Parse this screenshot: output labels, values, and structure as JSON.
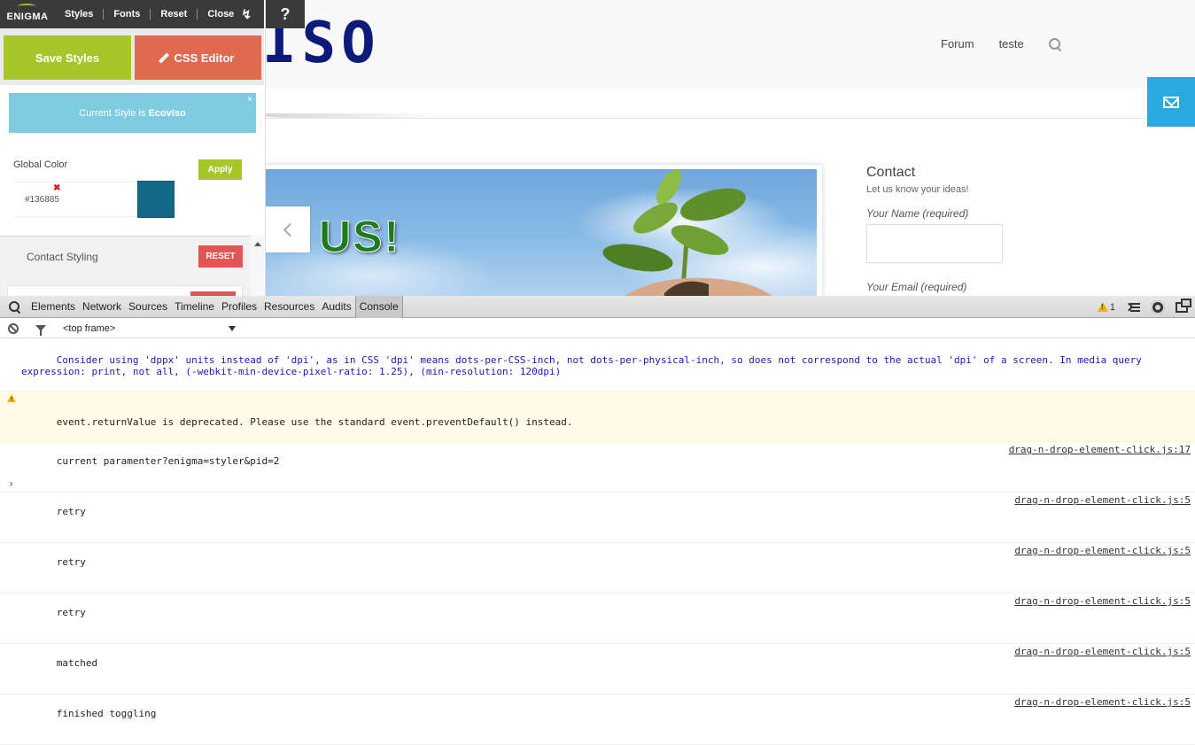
{
  "site": {
    "logo_text": "ISO",
    "nav": [
      "Forum",
      "teste"
    ],
    "slide_text": "US!",
    "contact": {
      "title": "Contact",
      "subtitle": "Let us know your ideas!",
      "name_label": "Your Name (required)",
      "email_label": "Your Email (required)"
    }
  },
  "enigma": {
    "toolbar": {
      "logo": "ENIGMA",
      "items": [
        "Styles",
        "Fonts",
        "Reset",
        "Close"
      ],
      "reload_icon": "↯",
      "help": "?"
    },
    "save_styles": "Save Styles",
    "css_editor": "CSS Editor",
    "current_style_prefix": "Current Style is",
    "current_style_name": "EcovIso",
    "close_x": "×",
    "global_color_label": "Global Color",
    "apply": "Apply",
    "color_value": "#136885",
    "swatch_color": "#136885",
    "clear_x": "✖",
    "contact_styling_label": "Contact Styling",
    "reset": "RESET"
  },
  "devtools": {
    "tabs": [
      "Elements",
      "Network",
      "Sources",
      "Timeline",
      "Profiles",
      "Resources",
      "Audits",
      "Console"
    ],
    "active_tab": "Console",
    "warning_count": "1",
    "frame_select": "<top frame>",
    "logs": [
      {
        "type": "info",
        "text": "Consider using 'dppx' units instead of 'dpi', as in CSS 'dpi' means dots-per-CSS-inch, not dots-per-physical-inch, so does not correspond to the actual 'dpi' of a screen. In media query expression: print, not all, (-webkit-min-device-pixel-ratio: 1.25), (min-resolution: 120dpi)",
        "source": ""
      },
      {
        "type": "warn",
        "text": "event.returnValue is deprecated. Please use the standard event.preventDefault() instead.",
        "source": ""
      },
      {
        "type": "log",
        "text": "current paramenter?enigma=styler&pid=2",
        "source": "drag-n-drop-element-click.js:17"
      },
      {
        "type": "log",
        "text": "retry",
        "source": "drag-n-drop-element-click.js:5"
      },
      {
        "type": "log",
        "text": "retry",
        "source": "drag-n-drop-element-click.js:5"
      },
      {
        "type": "log",
        "text": "retry",
        "source": "drag-n-drop-element-click.js:5"
      },
      {
        "type": "log",
        "text": "matched",
        "source": "drag-n-drop-element-click.js:5"
      },
      {
        "type": "log",
        "text": "finished toggling",
        "source": "drag-n-drop-element-click.js:5"
      }
    ],
    "prompt": "›"
  }
}
